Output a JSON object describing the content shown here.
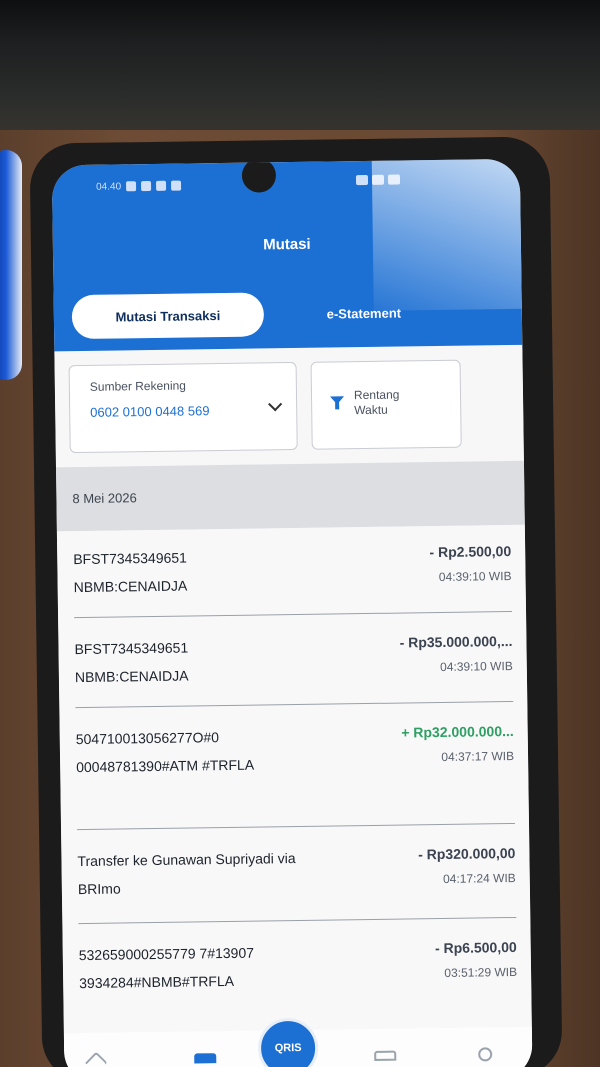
{
  "status_bar": {
    "time": "04.40"
  },
  "header": {
    "title": "Mutasi",
    "tabs": [
      {
        "label": "Mutasi Transaksi",
        "active": true
      },
      {
        "label": "e-Statement",
        "active": false
      }
    ]
  },
  "filters": {
    "source_label": "Sumber Rekening",
    "source_account": "0602 0100 0448 569",
    "range_label": "Rentang Waktu"
  },
  "date_header": "8 Mei 2026",
  "transactions": [
    {
      "desc": "BFST7345349651 NBMB:CENAIDJA",
      "amount": "- Rp2.500,00",
      "time": "04:39:10 WIB",
      "type": "debit"
    },
    {
      "desc": "BFST7345349651 NBMB:CENAIDJA",
      "amount": "- Rp35.000.000,...",
      "time": "04:39:10 WIB",
      "type": "debit"
    },
    {
      "desc": "504710013056277O#0 00048781390#ATM #TRFLA",
      "amount": "+ Rp32.000.000...",
      "time": "04:37:17 WIB",
      "type": "credit"
    },
    {
      "desc": "Transfer ke Gunawan Supriyadi via BRImo",
      "amount": "- Rp320.000,00",
      "time": "04:17:24 WIB",
      "type": "debit"
    },
    {
      "desc": "532659000255779 7#13907 3934284#NBMB#TRFLA",
      "amount": "- Rp6.500,00",
      "time": "03:51:29 WIB",
      "type": "debit"
    }
  ],
  "bottom_nav": {
    "qris_label": "QRIS"
  },
  "colors": {
    "brand_blue": "#1c6fd3",
    "credit_green": "#2ea063"
  }
}
